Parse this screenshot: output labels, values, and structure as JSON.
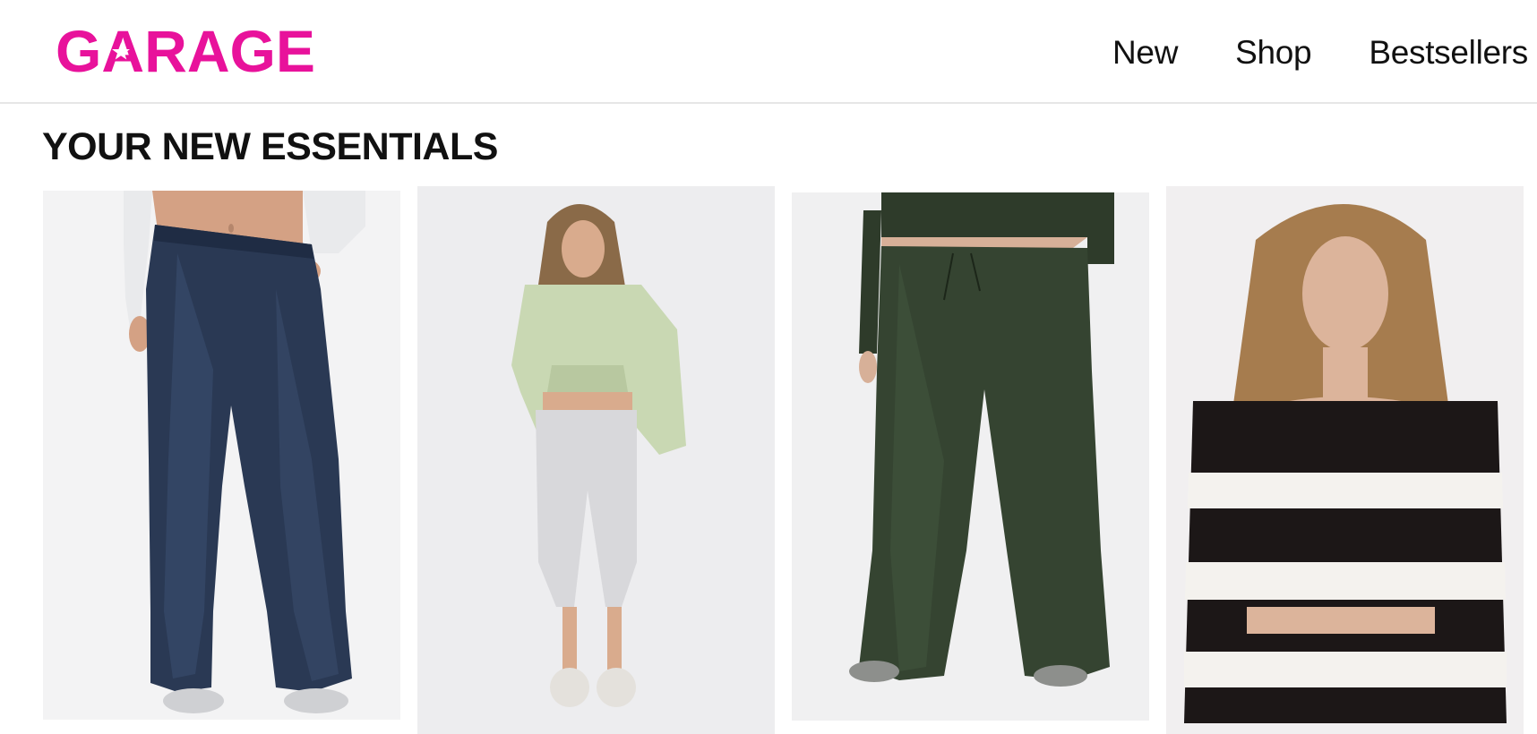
{
  "header": {
    "logo_text": "GARAGE",
    "logo_color": "#E8129B",
    "nav": [
      {
        "label": "New"
      },
      {
        "label": "Shop"
      },
      {
        "label": "Bestsellers"
      }
    ]
  },
  "main": {
    "section_title": "YOUR NEW ESSENTIALS",
    "products": [
      {
        "image": "model wearing dark wash baggy jeans and white top"
      },
      {
        "image": "model wearing sage green cropped hoodie and grey capri leggings"
      },
      {
        "image": "model wearing dark green wide leg drawstring pants"
      },
      {
        "image": "model wearing black and white striped off-shoulder top"
      }
    ]
  }
}
